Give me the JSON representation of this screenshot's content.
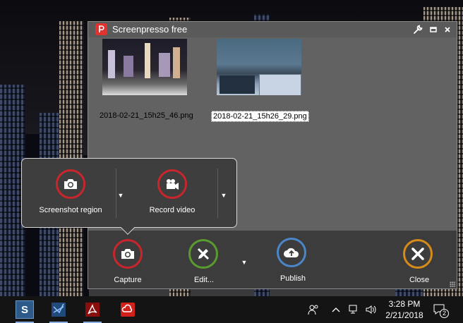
{
  "window": {
    "title": "Screenpresso free"
  },
  "gallery": [
    {
      "filename": "2018-02-21_15h25_46.png",
      "selected": false
    },
    {
      "filename": "2018-02-21_15h26_29.png",
      "selected": true
    }
  ],
  "popup": {
    "screenshot_region_label": "Screenshot region",
    "record_video_label": "Record video"
  },
  "toolbar": {
    "capture_label": "Capture",
    "edit_label": "Edit...",
    "publish_label": "Publish",
    "close_label": "Close"
  },
  "colors": {
    "capture_ring": "#c8262c",
    "edit_ring": "#5a9a2e",
    "publish_ring": "#4a86c8",
    "close_ring": "#d88a1a",
    "logo": "#e0322e"
  },
  "taskbar": {
    "apps": [
      "screenpresso-icon",
      "visual-studio-icon",
      "acrobat-icon",
      "creative-cloud-icon"
    ],
    "time": "3:28 PM",
    "date": "2/21/2018",
    "notification_count": "2"
  }
}
